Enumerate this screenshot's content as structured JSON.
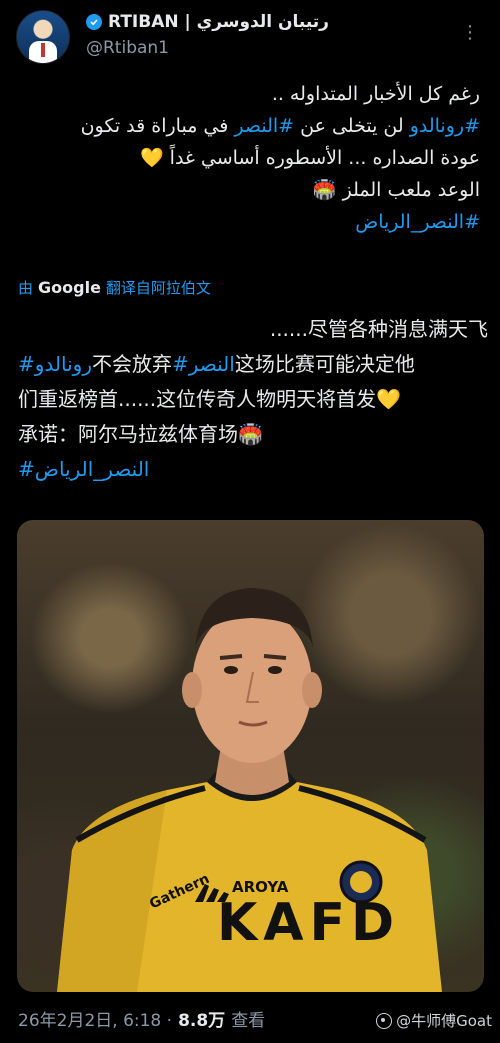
{
  "header": {
    "display_name": "RTIBAN | رتيبان الدوسري",
    "handle": "@Rtiban1",
    "more_label": "⋮"
  },
  "tweet_arabic": {
    "line1": "رغم كل الأخبار المتداوله ..",
    "line2_tag1": "#رونالدو",
    "line2_mid": " لن يتخلى عن ",
    "line2_tag2": "#النصر",
    "line2_end": " في مباراة قد تكون",
    "line3": "عودة الصداره ... الأسطوره أساسي غداً 💛",
    "line4": "الوعد ملعب الملز 🏟️",
    "line5_tag": "#النصر_الرياض"
  },
  "translation": {
    "prefix": "由",
    "provider": "Google",
    "label": "翻译自阿拉伯文"
  },
  "tweet_chinese": {
    "line1": "......尽管各种消息满天飞",
    "line2_tag1": "#رونالدو",
    "line2_a": "不会放弃",
    "line2_tag2": "#النصر",
    "line2_b": "这场比赛可能决定他",
    "line3": "们重返榜首......这位传奇人物明天将首发💛",
    "line4": "承诺：阿尔马拉兹体育场🏟️",
    "line5_tag": "#النصر_الرياض"
  },
  "media": {
    "jersey_sponsor": "KAFD",
    "jersey_brand": "AROYA",
    "jersey_maker": "Gathern"
  },
  "footer": {
    "date": "26年2月2日, 6:18 ·",
    "views": "8.8万",
    "views_label": "查看"
  },
  "watermark": {
    "text": "@牛师傅Goat"
  },
  "colors": {
    "link": "#1d9bf0",
    "background": "#000000",
    "jersey": "#e5b92a"
  }
}
